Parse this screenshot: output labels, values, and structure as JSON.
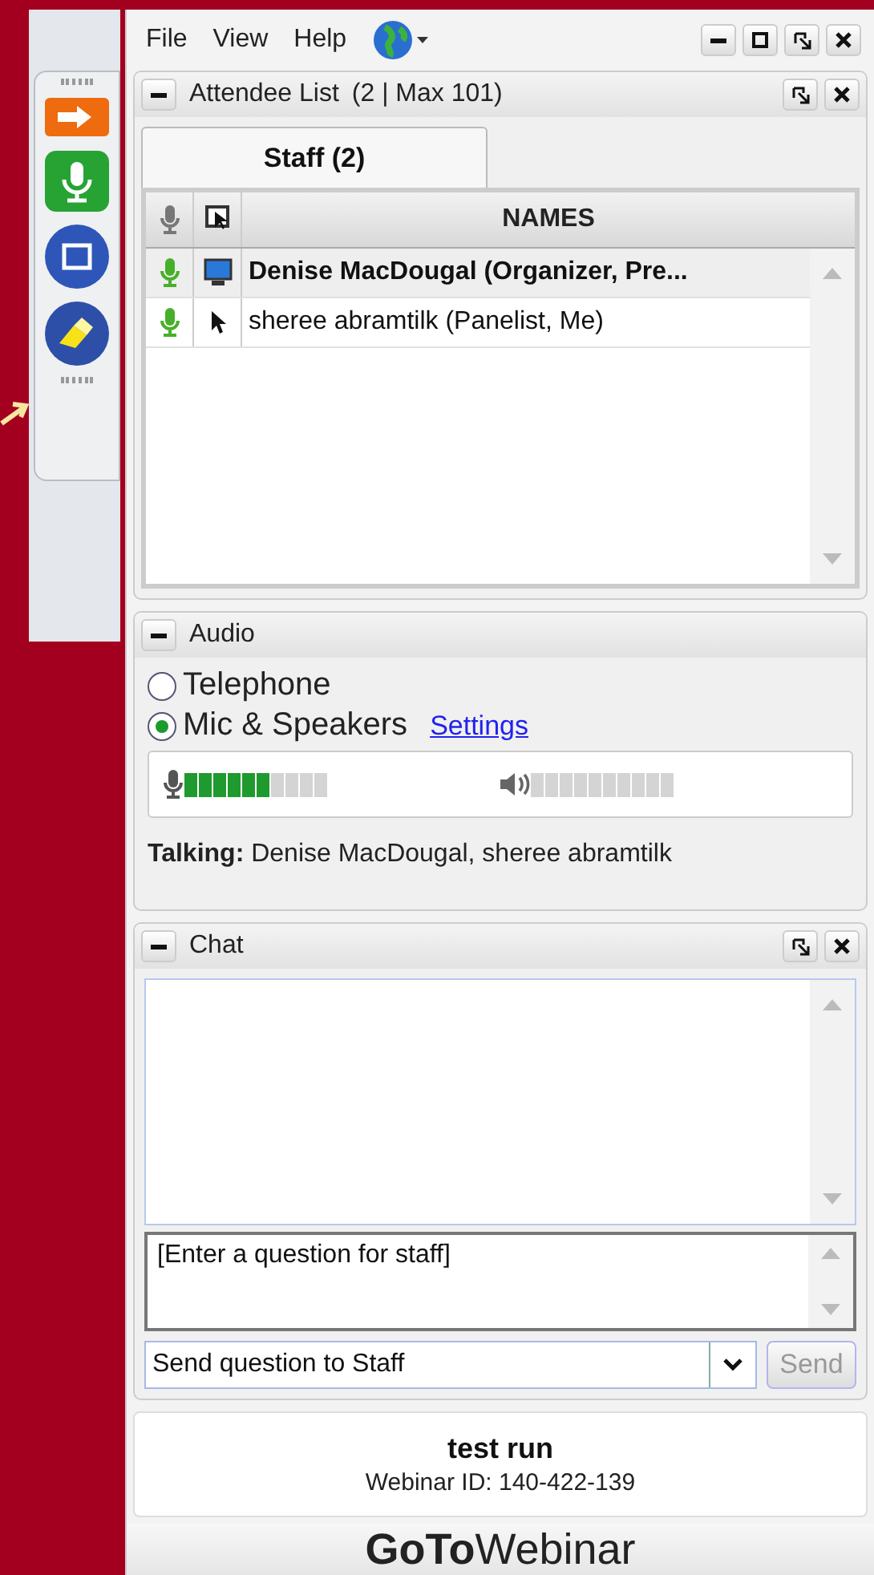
{
  "menu": {
    "items": [
      "File",
      "View",
      "Help"
    ]
  },
  "attendee_list": {
    "title": "Attendee List",
    "count": "(2 | Max 101)",
    "tabs": [
      {
        "label": "Staff (2)",
        "selected": true
      }
    ],
    "names_column": "NAMES",
    "rows": [
      {
        "name": "Denise MacDougal (Organizer, Pre...",
        "kind": "organizer",
        "mic_on": true,
        "presenting": true
      },
      {
        "name": "sheree abramtilk (Panelist, Me)",
        "kind": "panelist",
        "mic_on": true,
        "presenting": false
      }
    ]
  },
  "audio": {
    "title": "Audio",
    "options": [
      {
        "label": "Telephone",
        "selected": false
      },
      {
        "label": "Mic & Speakers",
        "selected": true
      }
    ],
    "settings_link": "Settings",
    "mic_meter": {
      "level": 0.6
    },
    "talking": "**Talking:** Denise MacDougal, sheree abramtilk"
  },
  "chat": {
    "title": "Chat",
    "question_placeholder": "[Enter a question for staff]",
    "recipient": "Send question to Staff",
    "send_button": {
      "label": "Send",
      "disabled": true
    }
  },
  "session": {
    "title": "test run",
    "webinar_id": "Webinar ID: 140-422-139"
  },
  "logo": "**GoTo**Webinar"
}
